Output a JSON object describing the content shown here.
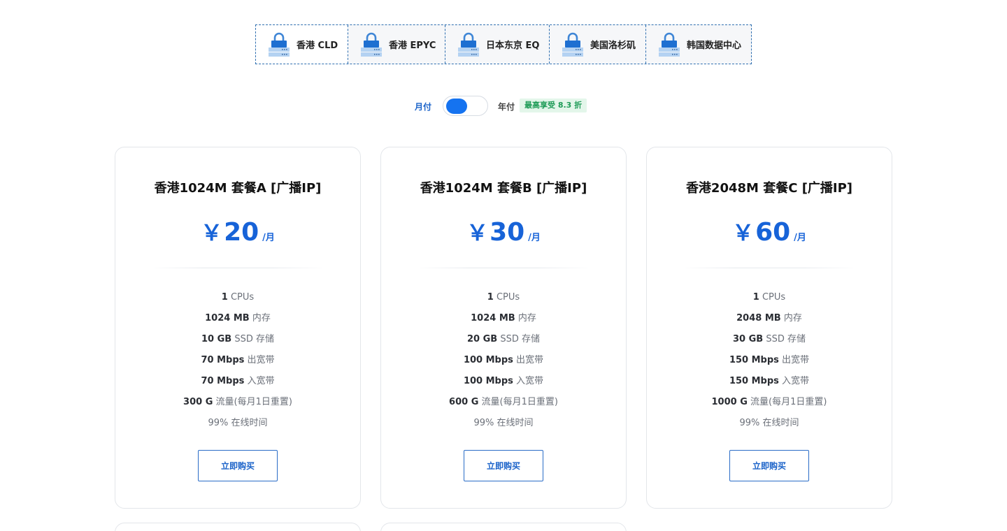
{
  "regions": [
    {
      "label": "香港 CLD",
      "active": true
    },
    {
      "label": "香港 EPYC",
      "active": false
    },
    {
      "label": "日本东京 EQ",
      "active": false
    },
    {
      "label": "美国洛杉矶",
      "active": false
    },
    {
      "label": "韩国数据中心",
      "active": false
    }
  ],
  "billing": {
    "monthly_label": "月付",
    "yearly_label": "年付",
    "discount": "最高享受 8.3 折",
    "selected": "monthly"
  },
  "plans": [
    {
      "name": "香港1024M 套餐A [广播IP]",
      "currency": "￥",
      "price": "20",
      "unit": "/月",
      "features": {
        "cpu": {
          "value": "1",
          "label": "CPUs"
        },
        "memory": {
          "value": "1024 MB",
          "label": "内存"
        },
        "disk": {
          "value": "10 GB",
          "label": "SSD 存储"
        },
        "egress": {
          "value": "70 Mbps",
          "label": "出宽带"
        },
        "ingress": {
          "value": "70 Mbps",
          "label": "入宽带"
        },
        "traffic": {
          "value": "300 G",
          "label": "流量(每月1日重置)"
        },
        "uptime": "99% 在线时间"
      },
      "button": "立即购买"
    },
    {
      "name": "香港1024M 套餐B [广播IP]",
      "currency": "￥",
      "price": "30",
      "unit": "/月",
      "features": {
        "cpu": {
          "value": "1",
          "label": "CPUs"
        },
        "memory": {
          "value": "1024 MB",
          "label": "内存"
        },
        "disk": {
          "value": "20 GB",
          "label": "SSD 存储"
        },
        "egress": {
          "value": "100 Mbps",
          "label": "出宽带"
        },
        "ingress": {
          "value": "100 Mbps",
          "label": "入宽带"
        },
        "traffic": {
          "value": "600 G",
          "label": "流量(每月1日重置)"
        },
        "uptime": "99% 在线时间"
      },
      "button": "立即购买"
    },
    {
      "name": "香港2048M 套餐C [广播IP]",
      "currency": "￥",
      "price": "60",
      "unit": "/月",
      "features": {
        "cpu": {
          "value": "1",
          "label": "CPUs"
        },
        "memory": {
          "value": "2048 MB",
          "label": "内存"
        },
        "disk": {
          "value": "30 GB",
          "label": "SSD 存储"
        },
        "egress": {
          "value": "150 Mbps",
          "label": "出宽带"
        },
        "ingress": {
          "value": "150 Mbps",
          "label": "入宽带"
        },
        "traffic": {
          "value": "1000 G",
          "label": "流量(每月1日重置)"
        },
        "uptime": "99% 在线时间"
      },
      "button": "立即购买"
    }
  ],
  "colors": {
    "accent": "#1763d8",
    "toggle": "#1573f0",
    "discount_text": "#1e9b57",
    "discount_bg": "#e3f6ea",
    "tab_border": "#2f6fb0"
  },
  "icons": {
    "region_tab": "server-lock-icon"
  }
}
